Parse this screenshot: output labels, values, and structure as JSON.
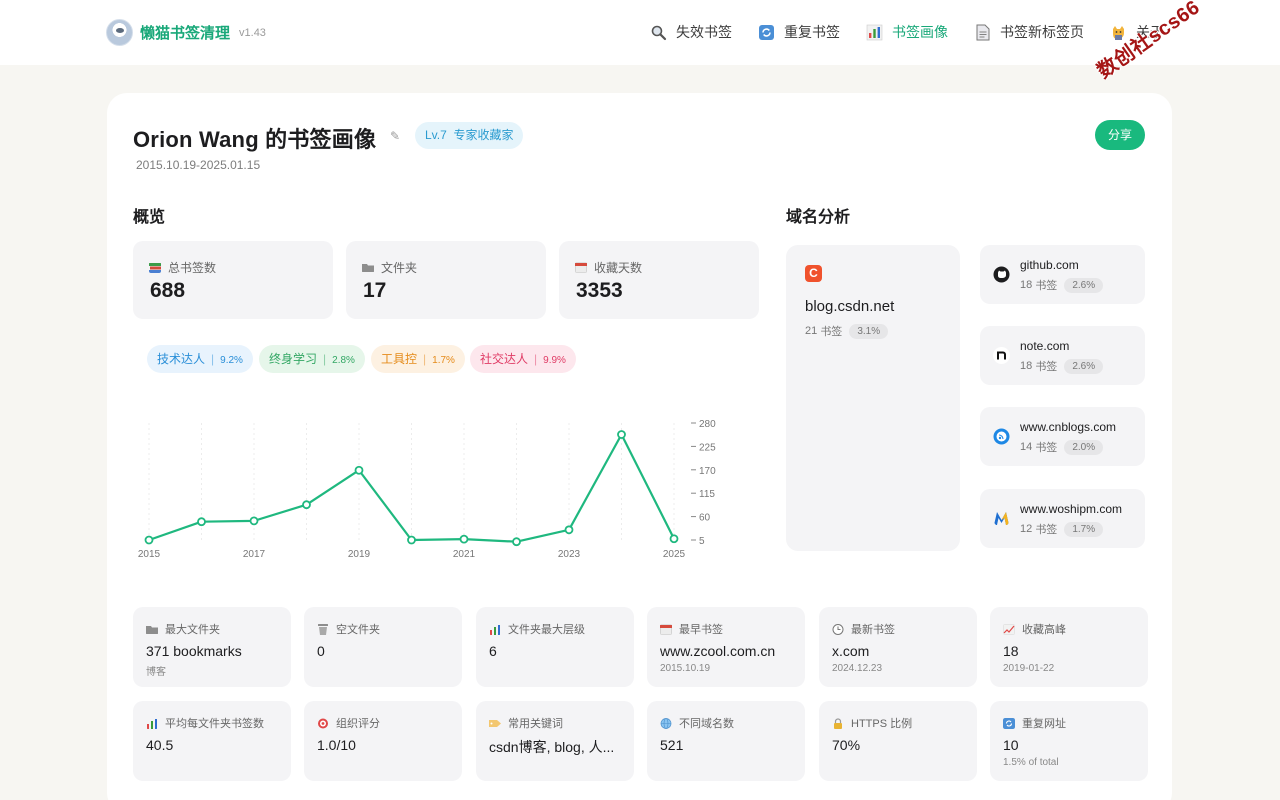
{
  "app": {
    "name": "懒猫书签清理",
    "version": "v1.43"
  },
  "nav": [
    {
      "label": "失效书签",
      "icon": "magnifier-icon"
    },
    {
      "label": "重复书签",
      "icon": "sync-icon"
    },
    {
      "label": "书签画像",
      "icon": "bar-chart-icon",
      "active": true
    },
    {
      "label": "书签新标签页",
      "icon": "page-icon"
    },
    {
      "label": "关于",
      "icon": "cat-icon"
    }
  ],
  "profile": {
    "title": "Orion Wang 的书签画像",
    "level_prefix": "Lv.7",
    "level_name": "专家收藏家",
    "date_range": "2015.10.19-2025.01.15",
    "share_label": "分享"
  },
  "overview": {
    "heading": "概览",
    "stats": [
      {
        "label": "总书签数",
        "value": "688"
      },
      {
        "label": "文件夹",
        "value": "17"
      },
      {
        "label": "收藏天数",
        "value": "3353"
      }
    ],
    "tags": [
      {
        "label": "技术达人",
        "pct": "9.2%",
        "color": "#2a8fd8",
        "bg": "#e8f3fd"
      },
      {
        "label": "终身学习",
        "pct": "2.8%",
        "color": "#33a764",
        "bg": "#e6f6ea"
      },
      {
        "label": "工具控",
        "pct": "1.7%",
        "color": "#e58b1a",
        "bg": "#fdf1e2"
      },
      {
        "label": "社交达人",
        "pct": "9.9%",
        "color": "#e03b65",
        "bg": "#fde7ed"
      }
    ]
  },
  "chart_data": {
    "type": "line",
    "x": [
      2015,
      2016,
      2017,
      2018,
      2019,
      2020,
      2021,
      2022,
      2023,
      2024,
      2025
    ],
    "series": [
      {
        "values": [
          5,
          48,
          50,
          88,
          169,
          5,
          7,
          1,
          29,
          253,
          8
        ]
      }
    ],
    "x_tick_labels": [
      "2015",
      "2017",
      "2019",
      "2021",
      "2023",
      "2025"
    ],
    "y_tick_labels": [
      "280",
      "225",
      "170",
      "115",
      "60",
      "5"
    ],
    "ylim": [
      5,
      280
    ],
    "color": "#1fb87f",
    "grid": "vertical-dashed",
    "y_axis_side": "right"
  },
  "domains": {
    "heading": "域名分析",
    "unit": "书签",
    "items": [
      {
        "name": "blog.csdn.net",
        "count": "21",
        "pct": "3.1%",
        "icon": "csdn-icon"
      },
      {
        "name": "github.com",
        "count": "18",
        "pct": "2.6%",
        "icon": "github-icon"
      },
      {
        "name": "note.com",
        "count": "18",
        "pct": "2.6%",
        "icon": "note-icon"
      },
      {
        "name": "www.cnblogs.com",
        "count": "14",
        "pct": "2.0%",
        "icon": "cnblogs-icon"
      },
      {
        "name": "www.woshipm.com",
        "count": "12",
        "pct": "1.7%",
        "icon": "woshipm-icon"
      }
    ]
  },
  "tiles": [
    {
      "label": "最大文件夹",
      "value": "371 bookmarks",
      "sub": "博客",
      "icon": "folder-icon"
    },
    {
      "label": "空文件夹",
      "value": "0",
      "sub": "",
      "icon": "trash-icon"
    },
    {
      "label": "文件夹最大层级",
      "value": "6",
      "sub": "",
      "icon": "bar-chart-icon"
    },
    {
      "label": "最早书签",
      "value": "www.zcool.com.cn",
      "sub": "2015.10.19",
      "icon": "calendar-icon"
    },
    {
      "label": "最新书签",
      "value": "x.com",
      "sub": "2024.12.23",
      "icon": "clock-icon"
    },
    {
      "label": "收藏高峰",
      "value": "18",
      "sub": "2019-01-22",
      "icon": "trend-icon"
    },
    {
      "label": "平均每文件夹书签数",
      "value": "40.5",
      "sub": "",
      "icon": "bar-chart-icon"
    },
    {
      "label": "组织评分",
      "value": "1.0/10",
      "sub": "",
      "icon": "target-icon"
    },
    {
      "label": "常用关键词",
      "value": "csdn博客, blog, 人...",
      "sub": "",
      "icon": "tag-icon"
    },
    {
      "label": "不同域名数",
      "value": "521",
      "sub": "",
      "icon": "globe-icon"
    },
    {
      "label": "HTTPS 比例",
      "value": "70%",
      "sub": "",
      "icon": "lock-icon"
    },
    {
      "label": "重复网址",
      "value": "10",
      "sub": "1.5% of total",
      "icon": "sync-icon"
    }
  ],
  "watermark": "数创社scs66"
}
